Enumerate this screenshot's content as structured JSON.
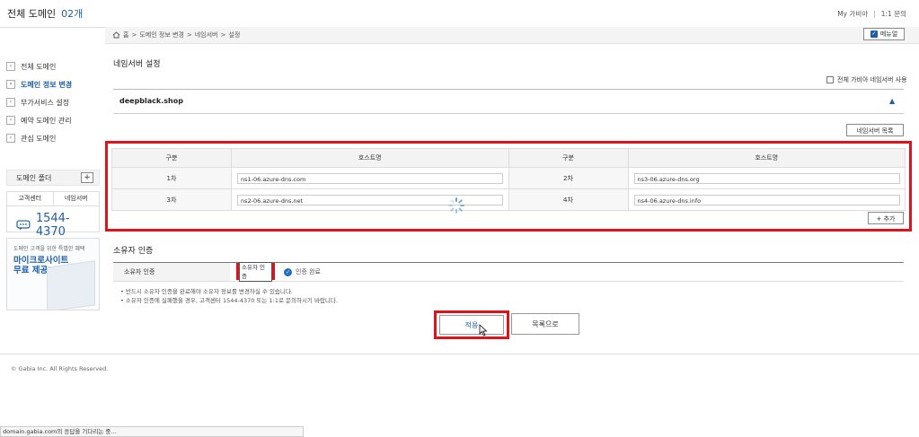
{
  "header": {
    "title": "전체 도메인",
    "count": "02개",
    "links": [
      "My 가비아",
      "1:1 문의"
    ]
  },
  "breadcrumb": {
    "items": [
      "홈",
      ">",
      "도메인 정보 변경",
      ">",
      "네임서버",
      ">",
      "설정"
    ],
    "manual_label": "메뉴얼"
  },
  "sidebar": {
    "items": [
      {
        "label": "전체 도메인"
      },
      {
        "label": "도메인 정보 변경"
      },
      {
        "label": "부가서비스 설정"
      },
      {
        "label": "예약 도메인 관리"
      },
      {
        "label": "관심 도메인"
      }
    ],
    "folder_label": "도메인 폴더",
    "support_tabs": [
      "고객센터",
      "네임서버"
    ],
    "phone": "1544-4370",
    "promo_sub": "도메인 고객을 위한 특별한 혜택",
    "promo_title_1": "마이크로사이트",
    "promo_title_2": "무료 제공!"
  },
  "main": {
    "title": "네임서버 설정",
    "all_use_label": "전체 가비아 네임서버 사용",
    "domain": "deepblack.shop",
    "ns_list_label": "네임서버 목록",
    "table": {
      "headers": [
        "구분",
        "호스트명",
        "구분",
        "호스트명"
      ],
      "rows": [
        {
          "l1": "1차",
          "h1": "ns1-06.azure-dns.com",
          "l2": "2차",
          "h2": "ns3-06.azure-dns.org"
        },
        {
          "l1": "3차",
          "h1": "ns2-06.azure-dns.net",
          "l2": "4차",
          "h2": "ns4-06.azure-dns.info"
        }
      ]
    },
    "add_label": "+ 추가",
    "owner": {
      "title": "소유자 인증",
      "label": "소유자 인증",
      "button": "소유자 인증",
      "status": "인증 완료",
      "notes": [
        "• 반드시 소유자 인증을 완료해야 소유자 정보를 변경하실 수 있습니다.",
        "• 소유자 인증에 실패했을 경우, 고객센터 1544-4370 또는 1:1로 문의하시기 바랍니다."
      ]
    },
    "apply_label": "적용",
    "list_label": "목록으로"
  },
  "footer": {
    "copyright": "© Gabia Inc. All Rights Reserved.",
    "status_bar": "domain.gabia.com의 응답을 기다리는 중..."
  }
}
